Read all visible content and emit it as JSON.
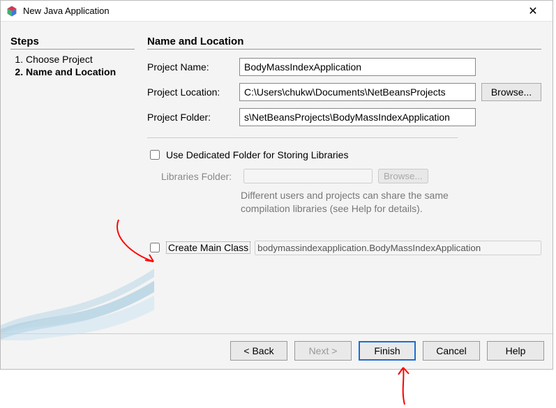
{
  "window": {
    "title": "New Java Application",
    "close_symbol": "✕"
  },
  "sidebar": {
    "heading": "Steps",
    "items": [
      {
        "label": "Choose Project",
        "current": false
      },
      {
        "label": "Name and Location",
        "current": true
      }
    ]
  },
  "main": {
    "heading": "Name and Location",
    "project_name_label": "Project Name:",
    "project_name_value": "BodyMassIndexApplication",
    "project_location_label": "Project Location:",
    "project_location_value": "C:\\Users\\chukw\\Documents\\NetBeansProjects",
    "project_folder_label": "Project Folder:",
    "project_folder_value": "s\\NetBeansProjects\\BodyMassIndexApplication",
    "browse_label": "Browse...",
    "dedicated_folder_label": "Use Dedicated Folder for Storing Libraries",
    "dedicated_folder_checked": false,
    "libraries_folder_label": "Libraries Folder:",
    "libraries_folder_value": "",
    "libraries_hint": "Different users and projects can share the same compilation libraries (see Help for details).",
    "create_main_label": "Create Main Class",
    "create_main_checked": false,
    "create_main_value": "bodymassindexapplication.BodyMassIndexApplication"
  },
  "buttons": {
    "back": "< Back",
    "next": "Next >",
    "finish": "Finish",
    "cancel": "Cancel",
    "help": "Help"
  }
}
